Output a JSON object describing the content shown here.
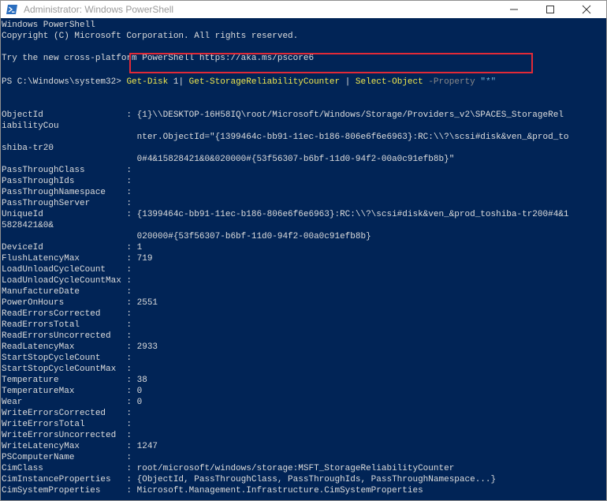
{
  "window": {
    "title": "Administrator: Windows PowerShell",
    "icon": "powershell-icon",
    "controls": [
      "minimize-icon",
      "maximize-icon",
      "close-icon"
    ]
  },
  "console": {
    "header_lines": [
      "Windows PowerShell",
      "Copyright (C) Microsoft Corporation. All rights reserved.",
      "",
      "Try the new cross-platform PowerShell https://aka.ms/pscore6"
    ],
    "prompt": "PS C:\\Windows\\system32> ",
    "command": {
      "part1": "Get-Disk",
      "part2": " 1",
      "part3": "| ",
      "part4": "Get-StorageReliabilityCounter",
      "part5": " | ",
      "part6": "Select-Object",
      "part7": " -Property ",
      "part8": "\"*\""
    },
    "output_lines": [
      {
        "row": 9,
        "text": "ObjectId                : {1}\\\\DESKTOP-16H58IQ\\root/Microsoft/Windows/Storage/Providers_v2\\SPACES_StorageRel"
      },
      {
        "row": 10,
        "text": "iabilityCou"
      },
      {
        "row": 11,
        "text": "                          nter.ObjectId=\"{1399464c-bb91-11ec-b186-806e6f6e6963}:RC:\\\\?\\scsi#disk&ven_&prod_to"
      },
      {
        "row": 12,
        "text": "shiba-tr20"
      },
      {
        "row": 13,
        "text": "                          0#4&15828421&0&020000#{53f56307-b6bf-11d0-94f2-00a0c91efb8b}\""
      },
      {
        "row": 14,
        "text": "PassThroughClass        :"
      },
      {
        "row": 15,
        "text": "PassThroughIds          :"
      },
      {
        "row": 16,
        "text": "PassThroughNamespace    :"
      },
      {
        "row": 17,
        "text": "PassThroughServer       :"
      },
      {
        "row": 18,
        "text": "UniqueId                : {1399464c-bb91-11ec-b186-806e6f6e6963}:RC:\\\\?\\scsi#disk&ven_&prod_toshiba-tr200#4&1"
      },
      {
        "row": 19,
        "text": "5828421&0&"
      },
      {
        "row": 20,
        "text": "                          020000#{53f56307-b6bf-11d0-94f2-00a0c91efb8b}"
      },
      {
        "row": 21,
        "text": "DeviceId                : 1"
      },
      {
        "row": 22,
        "text": "FlushLatencyMax         : 719"
      },
      {
        "row": 23,
        "text": "LoadUnloadCycleCount    :"
      },
      {
        "row": 24,
        "text": "LoadUnloadCycleCountMax :"
      },
      {
        "row": 25,
        "text": "ManufactureDate         :"
      },
      {
        "row": 26,
        "text": "PowerOnHours            : 2551"
      },
      {
        "row": 27,
        "text": "ReadErrorsCorrected     :"
      },
      {
        "row": 28,
        "text": "ReadErrorsTotal         :"
      },
      {
        "row": 29,
        "text": "ReadErrorsUncorrected   :"
      },
      {
        "row": 30,
        "text": "ReadLatencyMax          : 2933"
      },
      {
        "row": 31,
        "text": "StartStopCycleCount     :"
      },
      {
        "row": 32,
        "text": "StartStopCycleCountMax  :"
      },
      {
        "row": 33,
        "text": "Temperature             : 38"
      },
      {
        "row": 34,
        "text": "TemperatureMax          : 0"
      },
      {
        "row": 35,
        "text": "Wear                    : 0"
      },
      {
        "row": 36,
        "text": "WriteErrorsCorrected    :"
      },
      {
        "row": 37,
        "text": "WriteErrorsTotal        :"
      },
      {
        "row": 38,
        "text": "WriteErrorsUncorrected  :"
      },
      {
        "row": 39,
        "text": "WriteLatencyMax         : 1247"
      },
      {
        "row": 40,
        "text": "PSComputerName          :"
      },
      {
        "row": 41,
        "text": "CimClass                : root/microsoft/windows/storage:MSFT_StorageReliabilityCounter"
      },
      {
        "row": 42,
        "text": "CimInstanceProperties   : {ObjectId, PassThroughClass, PassThroughIds, PassThroughNamespace...}"
      },
      {
        "row": 43,
        "text": "CimSystemProperties     : Microsoft.Management.Infrastructure.CimSystemProperties"
      }
    ]
  },
  "colors": {
    "console_bg": "#012456",
    "console_text": "#dddddd",
    "cmdlet": "#f0e84e",
    "parameter": "#8a8a8a",
    "string": "#79b8d9",
    "highlight_border": "#e12a37"
  }
}
